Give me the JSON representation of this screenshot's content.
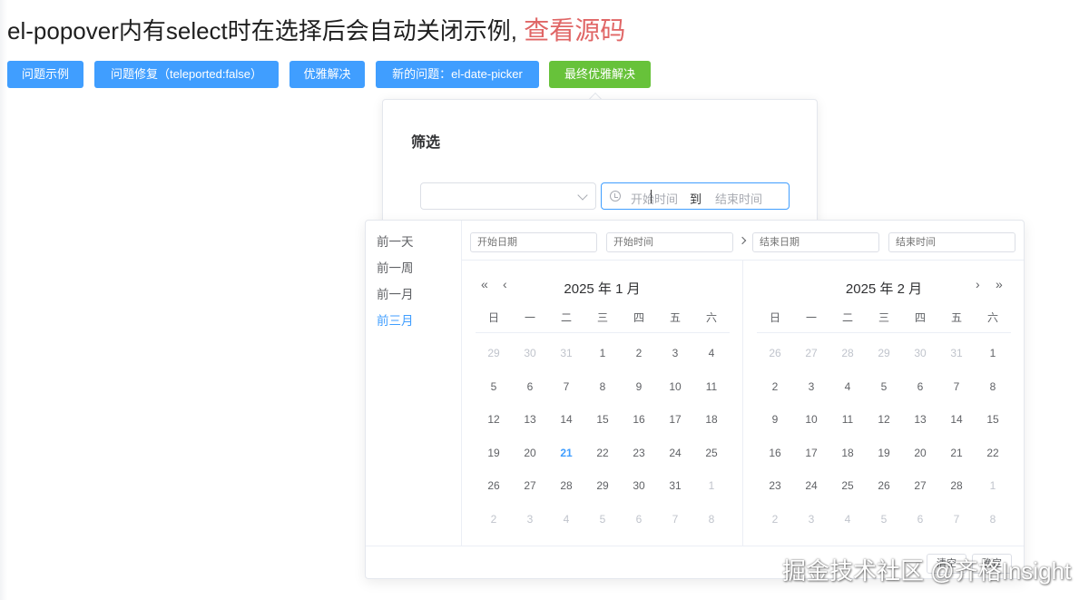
{
  "page": {
    "title": "el-popover内有select时在选择后会自动关闭示例,",
    "source_link": "查看源码"
  },
  "buttons": [
    {
      "label": "问题示例",
      "type": "primary"
    },
    {
      "label": "问题修复（teleported:false）",
      "type": "primary"
    },
    {
      "label": "优雅解决",
      "type": "primary"
    },
    {
      "label": "新的问题：el-date-picker",
      "type": "primary"
    },
    {
      "label": "最终优雅解决",
      "type": "success"
    }
  ],
  "popover": {
    "title": "筛选",
    "select_value": "",
    "range_start_placeholder": "开始时间",
    "range_separator": "到",
    "range_end_placeholder": "结束时间"
  },
  "picker": {
    "shortcuts": [
      "前一天",
      "前一周",
      "前一月",
      "前三月"
    ],
    "active_shortcut_index": 3,
    "header_inputs": {
      "start_date": "开始日期",
      "start_time": "开始时间",
      "end_date": "结束日期",
      "end_time": "结束时间"
    },
    "weekdays": [
      "日",
      "一",
      "二",
      "三",
      "四",
      "五",
      "六"
    ],
    "left_panel": {
      "title": "2025 年 1 月",
      "days": [
        [
          "29",
          "30",
          "31",
          "1",
          "2",
          "3",
          "4"
        ],
        [
          "5",
          "6",
          "7",
          "8",
          "9",
          "10",
          "11"
        ],
        [
          "12",
          "13",
          "14",
          "15",
          "16",
          "17",
          "18"
        ],
        [
          "19",
          "20",
          "21",
          "22",
          "23",
          "24",
          "25"
        ],
        [
          "26",
          "27",
          "28",
          "29",
          "30",
          "31",
          "1"
        ],
        [
          "2",
          "3",
          "4",
          "5",
          "6",
          "7",
          "8"
        ]
      ],
      "today": "21"
    },
    "right_panel": {
      "title": "2025 年 2 月",
      "days": [
        [
          "26",
          "27",
          "28",
          "29",
          "30",
          "31",
          "1"
        ],
        [
          "2",
          "3",
          "4",
          "5",
          "6",
          "7",
          "8"
        ],
        [
          "9",
          "10",
          "11",
          "12",
          "13",
          "14",
          "15"
        ],
        [
          "16",
          "17",
          "18",
          "19",
          "20",
          "21",
          "22"
        ],
        [
          "23",
          "24",
          "25",
          "26",
          "27",
          "28",
          "1"
        ],
        [
          "2",
          "3",
          "4",
          "5",
          "6",
          "7",
          "8"
        ]
      ]
    },
    "footer": {
      "clear_label": "清空",
      "confirm_label": "确定"
    }
  },
  "watermark": "掘金技术社区 @齐格Insight",
  "colors": {
    "primary": "#409eff",
    "success": "#67c23a",
    "link": "#e06666",
    "today": "#409eff"
  }
}
